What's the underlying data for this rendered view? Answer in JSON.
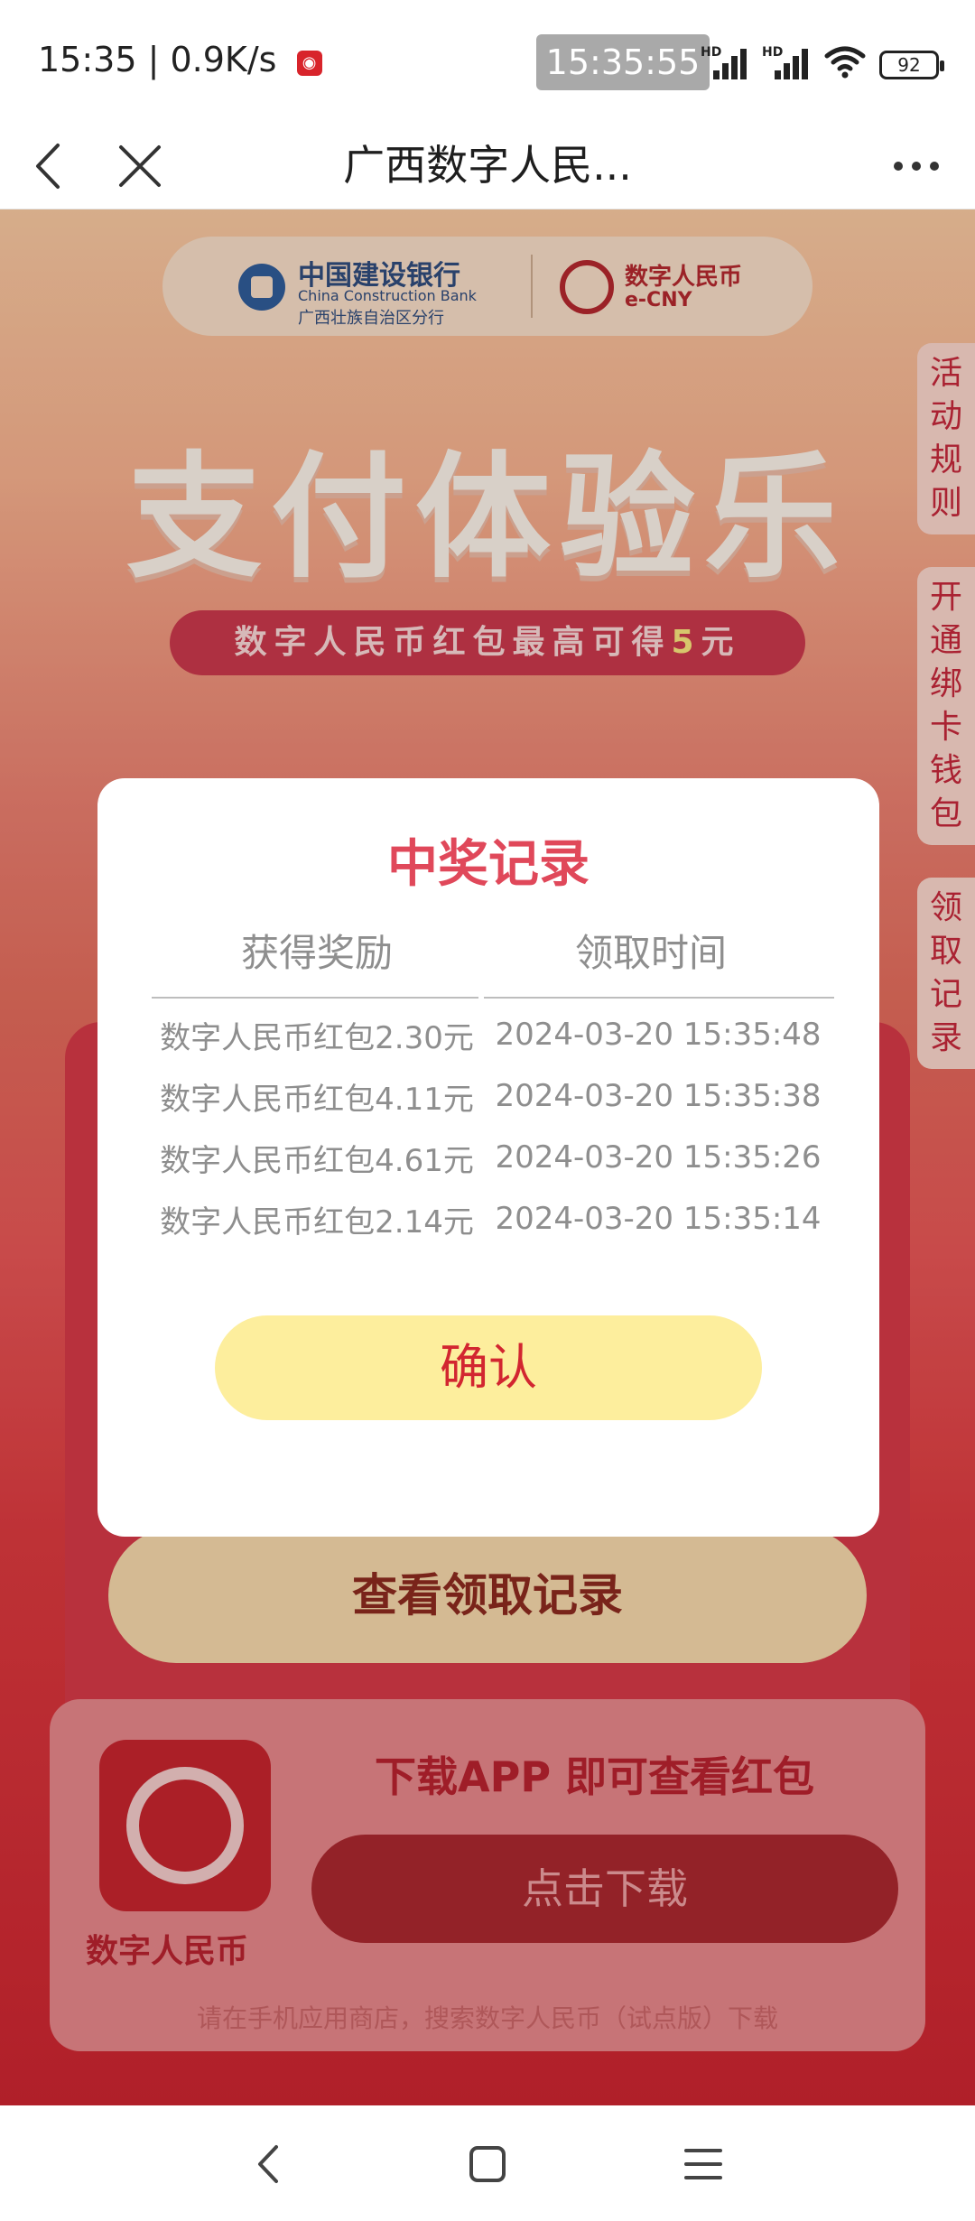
{
  "status_bar": {
    "time": "15:35",
    "net_speed": "0.9K/s",
    "clock_overlay": "15:35:55",
    "signal_1_label": "HD",
    "signal_2_label": "HD",
    "battery": "92"
  },
  "nav": {
    "title": "广西数字人民..."
  },
  "bank_banner": {
    "bank_name": "中国建设银行",
    "bank_name_en": "China Construction Bank",
    "bank_branch": "广西壮族自治区分行",
    "ecny_name": "数字人民币",
    "ecny_en": "e-CNY"
  },
  "hero": {
    "title": "支付体验乐",
    "subtitle_prefix": "数字人民币红包最高可得",
    "subtitle_amount": "5",
    "subtitle_unit": "元"
  },
  "side_tabs": {
    "rules": "活动规则",
    "bind_wallet": "开通绑卡钱包",
    "records": "领取记录"
  },
  "main": {
    "record_button": "查看领取记录"
  },
  "download": {
    "app_label": "数字人民币",
    "heading": "下载APP 即可查看红包",
    "button": "点击下载",
    "hint": "请在手机应用商店，搜索数字人民币（试点版）下载"
  },
  "modal": {
    "title": "中奖记录",
    "col_reward": "获得奖励",
    "col_time": "领取时间",
    "rows": [
      {
        "reward": "数字人民币红包2.30元",
        "time": "2024-03-20 15:35:48"
      },
      {
        "reward": "数字人民币红包4.11元",
        "time": "2024-03-20 15:35:38"
      },
      {
        "reward": "数字人民币红包4.61元",
        "time": "2024-03-20 15:35:26"
      },
      {
        "reward": "数字人民币红包2.14元",
        "time": "2024-03-20 15:35:14"
      }
    ],
    "confirm": "确认"
  },
  "colors": {
    "accent_red": "#e0485a",
    "confirm_bg": "#fdee9d",
    "confirm_text": "#d22630"
  },
  "icons": {
    "back": "chevron-left-icon",
    "close": "close-icon",
    "more": "more-dots-icon",
    "wifi": "wifi-icon",
    "battery": "battery-icon",
    "sys_back": "back-icon",
    "sys_home": "home-icon",
    "sys_menu": "menu-icon"
  }
}
